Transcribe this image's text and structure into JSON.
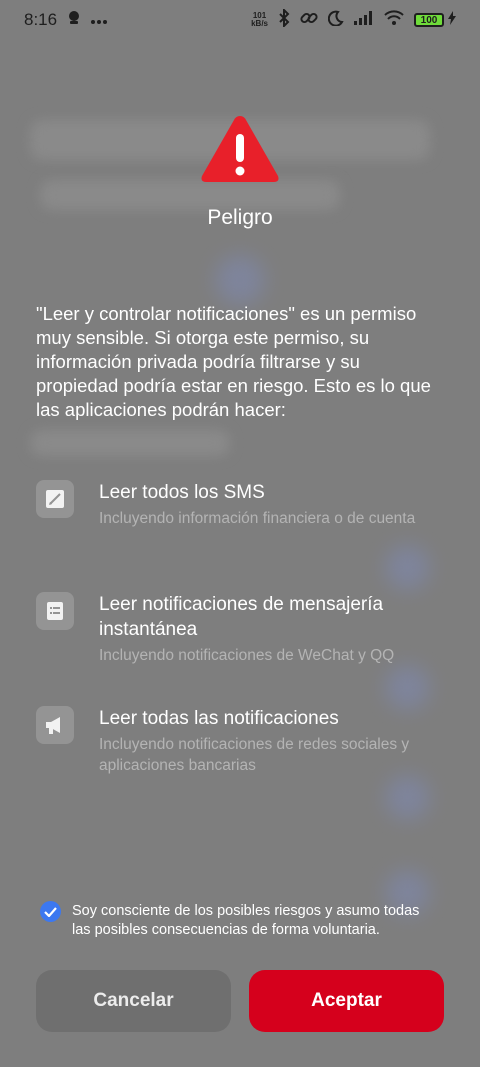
{
  "status_bar": {
    "time": "8:16",
    "net_speed_value": "101",
    "net_speed_unit": "kB/s",
    "battery": "100",
    "icons": [
      "face-icon",
      "more-icon",
      "bluetooth-icon",
      "link-icon",
      "moon-icon",
      "signal-icon",
      "wifi-icon",
      "battery-icon",
      "charging-icon"
    ]
  },
  "dialog": {
    "title": "Peligro",
    "description": "\"Leer y controlar notificaciones\" es un permiso muy sensible. Si otorga este permiso, su información privada podría filtrarse y su propiedad podría estar en riesgo. Esto es lo que las aplicaciones podrán hacer:",
    "permissions": [
      {
        "title": "Leer todos los SMS",
        "subtitle": "Incluyendo información financiera o de cuenta",
        "icon": "sms-icon"
      },
      {
        "title": "Leer notificaciones de mensajería instantánea",
        "subtitle": "Incluyendo notificaciones de WeChat y QQ",
        "icon": "chat-list-icon"
      },
      {
        "title": "Leer todas las notificaciones",
        "subtitle": "Incluyendo notificaciones de redes sociales y aplicaciones bancarias",
        "icon": "megaphone-icon"
      }
    ],
    "consent": {
      "checked": true,
      "text": "Soy consciente de los posibles riesgos y asumo todas las posibles consecuencias de forma voluntaria."
    },
    "cancel_label": "Cancelar",
    "accept_label": "Aceptar"
  },
  "colors": {
    "accent_red": "#d5001c",
    "warning_red": "#e8202a",
    "checkbox_blue": "#3c78f0",
    "overlay_gray": "#7e7e7e"
  }
}
